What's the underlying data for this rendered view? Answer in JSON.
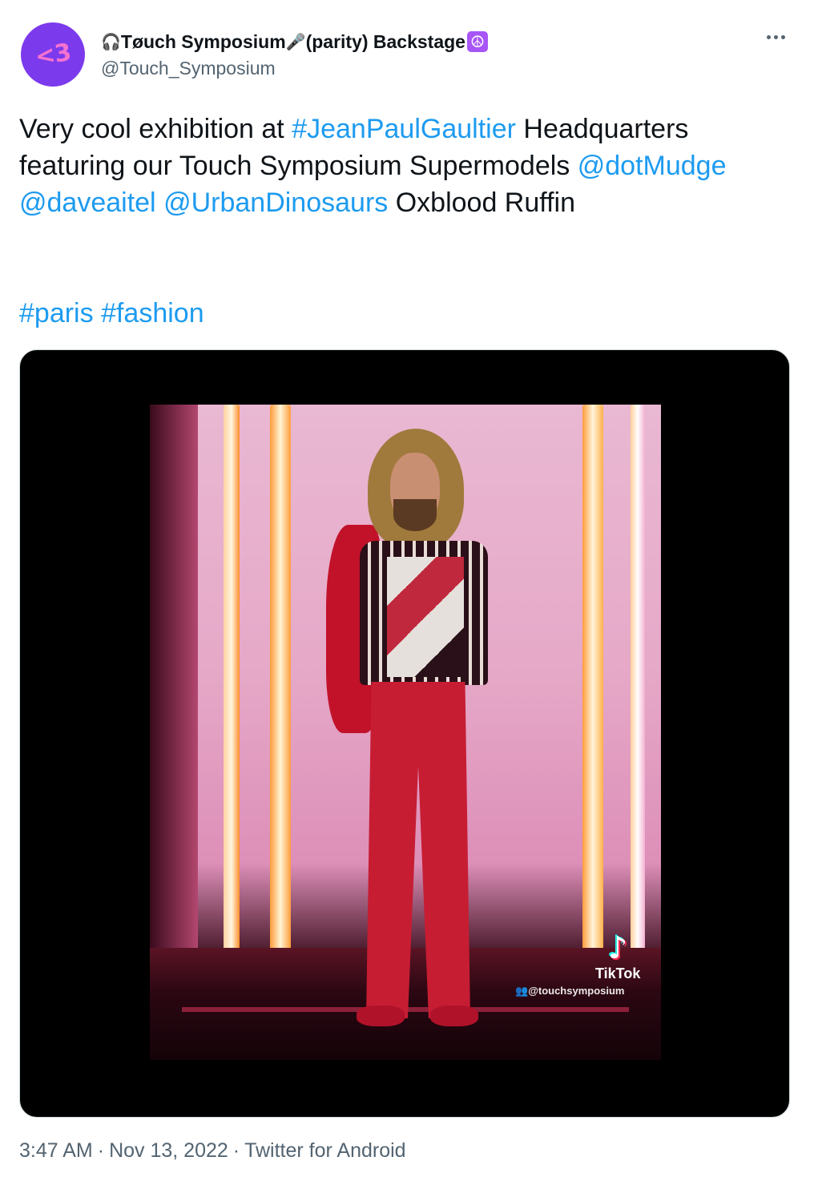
{
  "author": {
    "avatar_text": "<3",
    "display_name_prefix_icon": "headphones-icon",
    "display_name_part1": "Tøuch Symposium",
    "display_name_mid_icon": "microphone-notes-icon",
    "display_name_part2": " (parity) Backstage",
    "display_name_suffix_icon": "peace-icon",
    "handle": "@Touch_Symposium"
  },
  "tweet": {
    "text_1": "Very cool exhibition at ",
    "hashtag_1": "#JeanPaulGaultier",
    "text_2": " Headquarters featuring our Touch Symposium Supermodels ",
    "mention_1": "@dotMudge",
    "mention_2": "@daveaitel",
    "mention_3": "@UrbanDinosaurs",
    "text_3": " Oxblood Ruffin",
    "hashtag_2": "#paris",
    "hashtag_3": "#fashion"
  },
  "media": {
    "watermark_label": "TikTok",
    "watermark_handle": "@touchsymposium"
  },
  "meta": {
    "time": "3:47 AM",
    "date": "Nov 13, 2022",
    "source": "Twitter for Android",
    "separator": "·"
  },
  "colors": {
    "link": "#1d9bf0",
    "muted": "#536471",
    "avatar_bg": "#7c3aed"
  }
}
